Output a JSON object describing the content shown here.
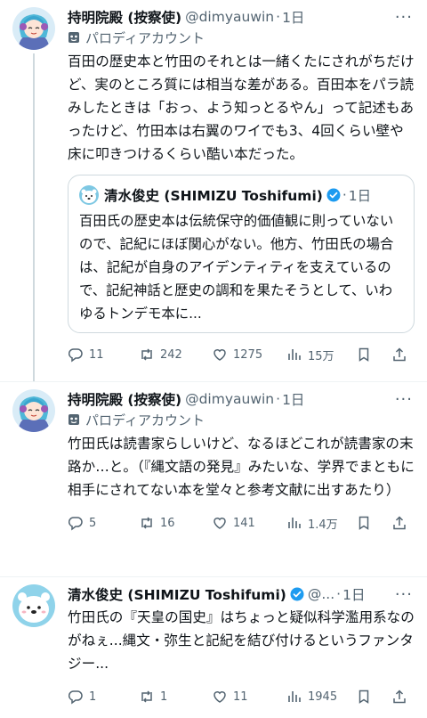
{
  "colors": {
    "accent": "#1d9bf0",
    "muted": "#536471",
    "border": "#cfd9de",
    "like_text": "#536471"
  },
  "tweets": [
    {
      "name": "持明院殿 (按察使)",
      "handle": "@dimyauwin",
      "separator": "·",
      "time": "1日",
      "more": "···",
      "parody_label": "パロディアカウント",
      "text": "百田の歴史本と竹田のそれとは一緒くたにされがちだけど、実のところ質には相当な差がある。百田本をパラ読みしたときは「おっ、よう知っとるやん」って記述もあったけど、竹田本は右翼のワイでも3、4回くらい壁や床に叩きつけるくらい酷い本だった。",
      "quote": {
        "name": "清水俊史 (SHIMIZU Toshifumi)",
        "separator": "·",
        "time": "1日",
        "text": "百田氏の歴史本は伝統保守的価値観に則っていないので、記紀にほぼ関心がない。他方、竹田氏の場合は、記紀が自身のアイデンティティを支えているので、記紀神話と歴史の調和を果たそうとして、いわゆるトンデモ本に..."
      },
      "replies": "11",
      "retweets": "242",
      "likes": "1275",
      "views": "15万"
    },
    {
      "name": "持明院殿 (按察使)",
      "handle": "@dimyauwin",
      "separator": "·",
      "time": "1日",
      "more": "···",
      "parody_label": "パロディアカウント",
      "text": "竹田氏は読書家らしいけど、なるほどこれが読書家の末路か…と。（『縄文語の発見』みたいな、学界でまともに相手にされてない本を堂々と参考文献に出すあたり）",
      "replies": "5",
      "retweets": "16",
      "likes": "141",
      "views": "1.4万"
    },
    {
      "name": "清水俊史 (SHIMIZU Toshifumi)",
      "handle": "@...",
      "separator": "·",
      "time": "1日",
      "more": "···",
      "text": "竹田氏の『天皇の国史』はちょっと疑似科学濫用系なのがねぇ...縄文・弥生と記紀を結び付けるというファンタジー...",
      "replies": "1",
      "retweets": "1",
      "likes": "11",
      "views": "1945"
    }
  ]
}
